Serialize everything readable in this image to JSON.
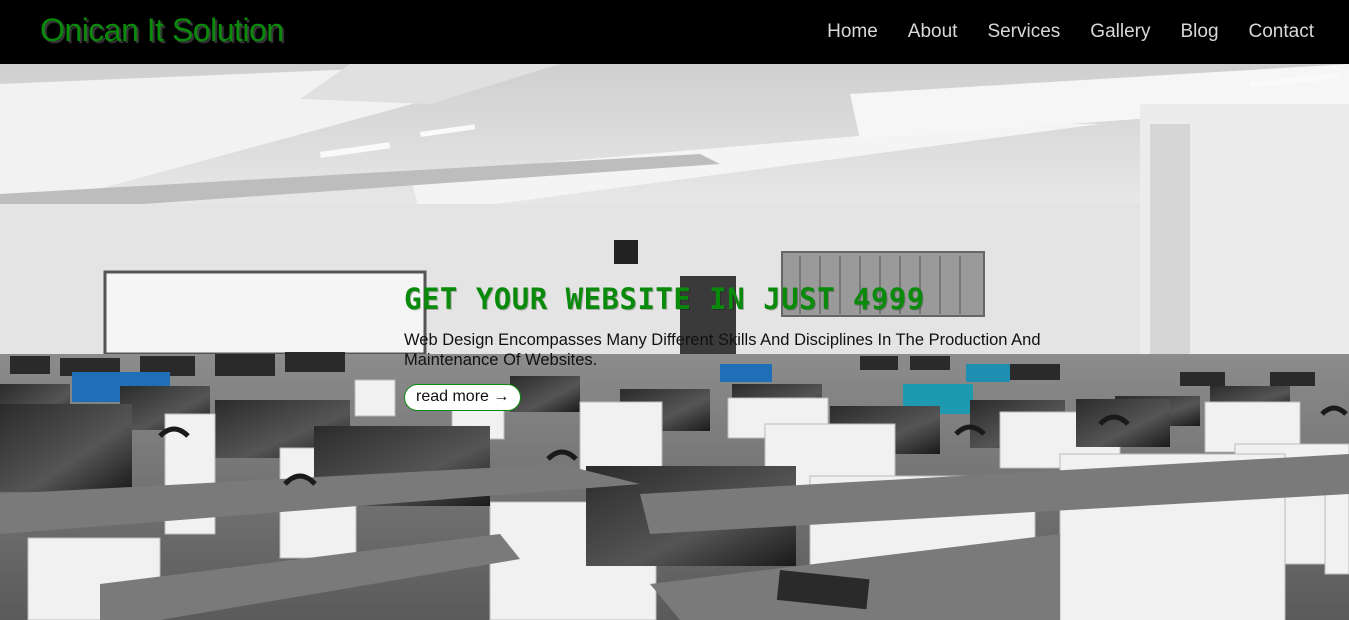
{
  "header": {
    "brand": "Onican It Solution",
    "nav": [
      {
        "label": "Home"
      },
      {
        "label": "About"
      },
      {
        "label": "Services"
      },
      {
        "label": "Gallery"
      },
      {
        "label": "Blog"
      },
      {
        "label": "Contact"
      }
    ]
  },
  "hero": {
    "title": "GET YOUR WEBSITE IN JUST 4999",
    "subtitle": "Web Design Encompasses Many Different Skills And Disciplines In The Production And Maintenance Of Websites.",
    "button_label": "read more →"
  },
  "colors": {
    "brand_green": "#0a8a0a",
    "navbar_bg": "#000000",
    "nav_text": "#d8d8d8"
  }
}
